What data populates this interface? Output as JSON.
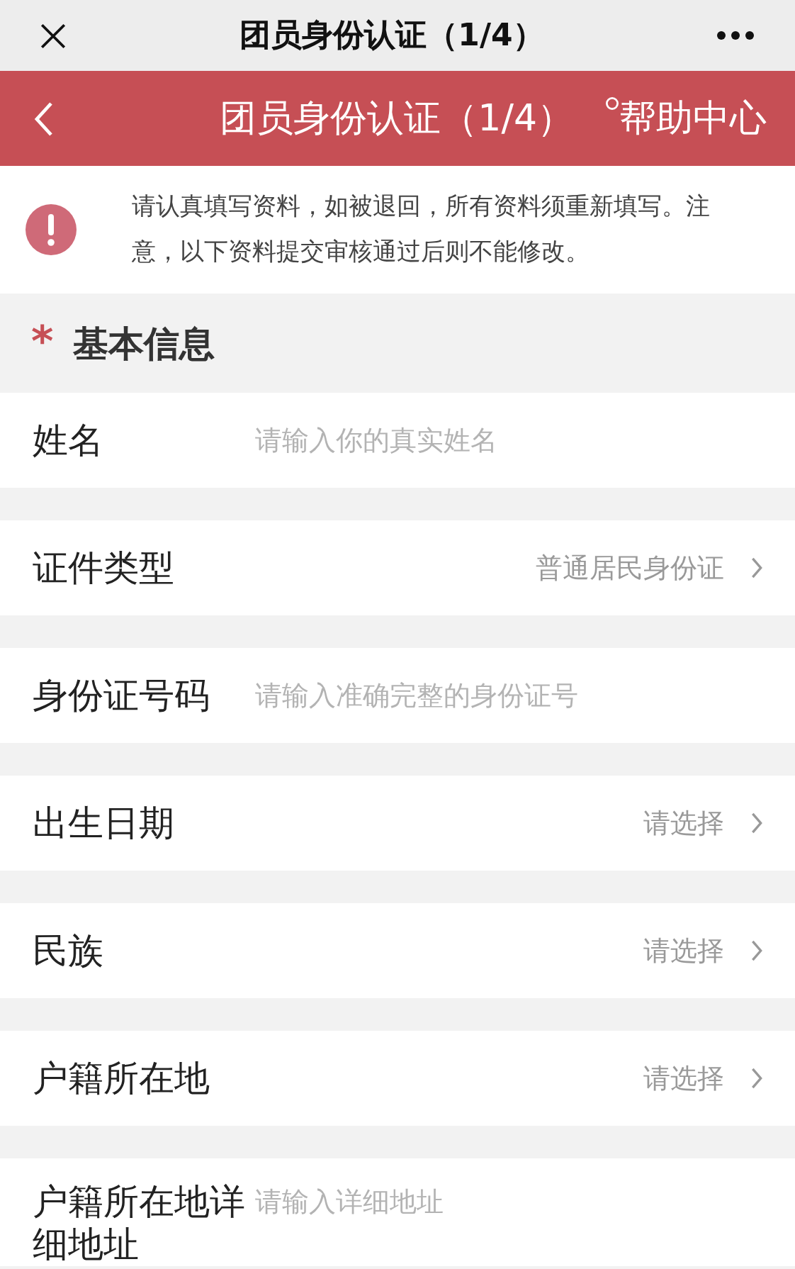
{
  "top_bar": {
    "title": "团员身份认证（1/4）"
  },
  "header": {
    "title": "团员身份认证（1/4）",
    "help_link": "帮助中心"
  },
  "notice": {
    "text": "请认真填写资料，如被退回，所有资料须重新填写。注意，以下资料提交审核通过后则不能修改。"
  },
  "section": {
    "mark": "*",
    "title": "基本信息"
  },
  "fields": [
    {
      "kind": "input",
      "label": "姓名",
      "placeholder": "请输入你的真实姓名"
    },
    {
      "kind": "select",
      "label": "证件类型",
      "value": "普通居民身份证"
    },
    {
      "kind": "input",
      "label": "身份证号码",
      "placeholder": "请输入准确完整的身份证号"
    },
    {
      "kind": "select",
      "label": "出生日期",
      "value": "请选择"
    },
    {
      "kind": "select",
      "label": "民族",
      "value": "请选择"
    },
    {
      "kind": "select",
      "label": "户籍所在地",
      "value": "请选择"
    },
    {
      "kind": "input",
      "label": "户籍所在地详细地址",
      "placeholder": "请输入详细地址"
    }
  ]
}
